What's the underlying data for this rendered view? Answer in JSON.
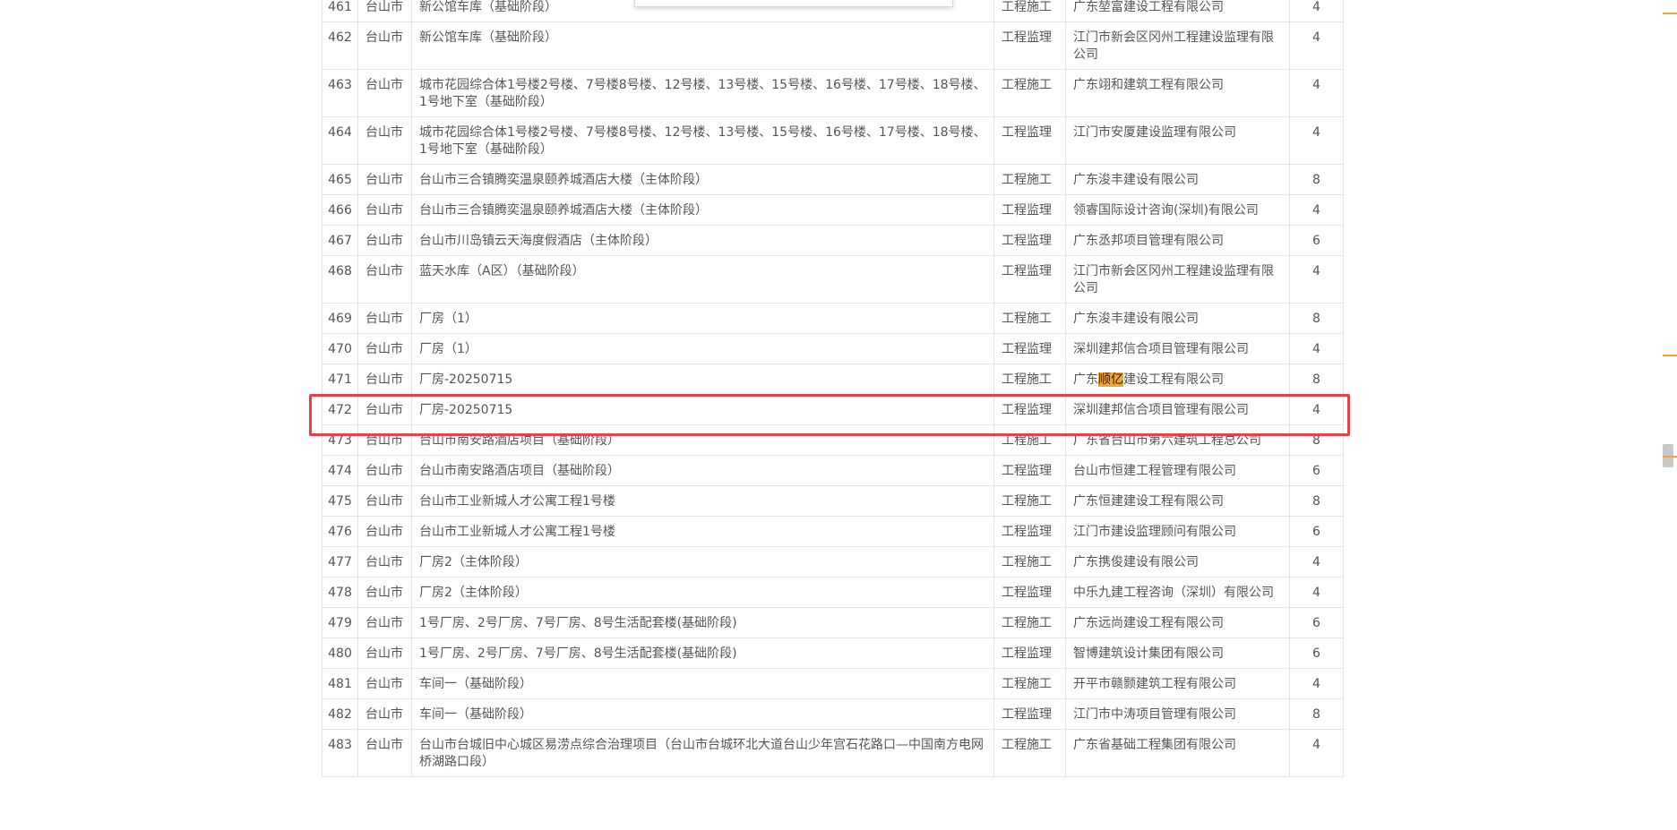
{
  "table": {
    "rows": [
      {
        "no": "461",
        "city": "台山市",
        "project": "新公馆车库（基础阶段）",
        "type": "工程施工",
        "company": "广东堃富建设工程有限公司",
        "score": "4"
      },
      {
        "no": "462",
        "city": "台山市",
        "project": "新公馆车库（基础阶段）",
        "type": "工程监理",
        "company": "江门市新会区冈州工程建设监理有限公司",
        "score": "4"
      },
      {
        "no": "463",
        "city": "台山市",
        "project": "城市花园综合体1号楼2号楼、7号楼8号楼、12号楼、13号楼、15号楼、16号楼、17号楼、18号楼、1号地下室（基础阶段）",
        "type": "工程施工",
        "company": "广东翊和建筑工程有限公司",
        "score": "4"
      },
      {
        "no": "464",
        "city": "台山市",
        "project": "城市花园综合体1号楼2号楼、7号楼8号楼、12号楼、13号楼、15号楼、16号楼、17号楼、18号楼、1号地下室（基础阶段）",
        "type": "工程监理",
        "company": "江门市安厦建设监理有限公司",
        "score": "4"
      },
      {
        "no": "465",
        "city": "台山市",
        "project": "台山市三合镇腾奕温泉颐养城酒店大楼（主体阶段）",
        "type": "工程施工",
        "company": "广东浚丰建设有限公司",
        "score": "8"
      },
      {
        "no": "466",
        "city": "台山市",
        "project": "台山市三合镇腾奕温泉颐养城酒店大楼（主体阶段）",
        "type": "工程监理",
        "company": "领睿国际设计咨询(深圳)有限公司",
        "score": "4"
      },
      {
        "no": "467",
        "city": "台山市",
        "project": "台山市川岛镇云天海度假酒店（主体阶段）",
        "type": "工程监理",
        "company": "广东丞邦项目管理有限公司",
        "score": "6"
      },
      {
        "no": "468",
        "city": "台山市",
        "project": "蓝天水库（A区）（基础阶段）",
        "type": "工程监理",
        "company": "江门市新会区冈州工程建设监理有限公司",
        "score": "4"
      },
      {
        "no": "469",
        "city": "台山市",
        "project": "厂房（1）",
        "type": "工程施工",
        "company": "广东浚丰建设有限公司",
        "score": "8"
      },
      {
        "no": "470",
        "city": "台山市",
        "project": "厂房（1）",
        "type": "工程监理",
        "company": "深圳建邦信合项目管理有限公司",
        "score": "4"
      },
      {
        "no": "471",
        "city": "台山市",
        "project": "厂房-20250715",
        "type": "工程施工",
        "company_pre": "广东",
        "company_hl": "顺亿",
        "company_post": "建设工程有限公司",
        "score": "8"
      },
      {
        "no": "472",
        "city": "台山市",
        "project": "厂房-20250715",
        "type": "工程监理",
        "company": "深圳建邦信合项目管理有限公司",
        "score": "4"
      },
      {
        "no": "473",
        "city": "台山市",
        "project": "台山市南安路酒店项目（基础阶段）",
        "type": "工程施工",
        "company": "广东省台山市第六建筑工程总公司",
        "score": "8"
      },
      {
        "no": "474",
        "city": "台山市",
        "project": "台山市南安路酒店项目（基础阶段）",
        "type": "工程监理",
        "company": "台山市恒建工程管理有限公司",
        "score": "6"
      },
      {
        "no": "475",
        "city": "台山市",
        "project": "台山市工业新城人才公寓工程1号楼",
        "type": "工程施工",
        "company": "广东恒建建设工程有限公司",
        "score": "8"
      },
      {
        "no": "476",
        "city": "台山市",
        "project": "台山市工业新城人才公寓工程1号楼",
        "type": "工程监理",
        "company": "江门市建设监理顾问有限公司",
        "score": "6"
      },
      {
        "no": "477",
        "city": "台山市",
        "project": "厂房2（主体阶段）",
        "type": "工程施工",
        "company": "广东携俊建设有限公司",
        "score": "4"
      },
      {
        "no": "478",
        "city": "台山市",
        "project": "厂房2（主体阶段）",
        "type": "工程监理",
        "company": "中乐九建工程咨询（深圳）有限公司",
        "score": "4"
      },
      {
        "no": "479",
        "city": "台山市",
        "project": "1号厂房、2号厂房、7号厂房、8号生活配套楼(基础阶段)",
        "type": "工程施工",
        "company": "广东远尚建设工程有限公司",
        "score": "6"
      },
      {
        "no": "480",
        "city": "台山市",
        "project": "1号厂房、2号厂房、7号厂房、8号生活配套楼(基础阶段)",
        "type": "工程监理",
        "company": "智博建筑设计集团有限公司",
        "score": "6"
      },
      {
        "no": "481",
        "city": "台山市",
        "project": "车间一（基础阶段）",
        "type": "工程施工",
        "company": "开平市赣颢建筑工程有限公司",
        "score": "4"
      },
      {
        "no": "482",
        "city": "台山市",
        "project": "车间一（基础阶段）",
        "type": "工程监理",
        "company": "江门市中涛项目管理有限公司",
        "score": "8"
      },
      {
        "no": "483",
        "city": "台山市",
        "project": "台山市台城旧中心城区易涝点综合治理项目（台山市台城环北大道台山少年宫石花路口—中国南方电网桥湖路口段）",
        "type": "工程施工",
        "company": "广东省基础工程集团有限公司",
        "score": "4"
      }
    ]
  }
}
